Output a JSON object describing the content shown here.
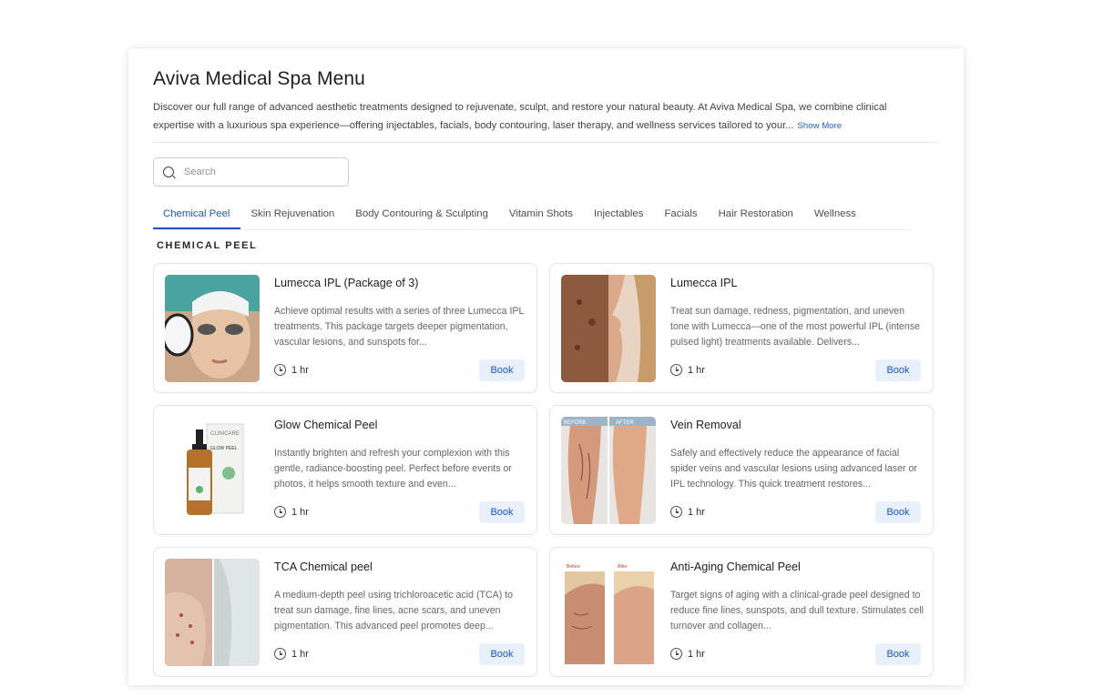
{
  "menu": {
    "title": "Aviva Medical Spa Menu",
    "description": "Discover our full range of advanced aesthetic treatments designed to rejuvenate, sculpt, and restore your natural beauty. At Aviva Medical Spa, we combine clinical expertise with a luxurious spa experience—offering injectables, facials, body contouring, laser therapy, and wellness services tailored to your...",
    "show_more_label": "Show More"
  },
  "search": {
    "placeholder": "Search",
    "value": ""
  },
  "tabs": [
    {
      "label": "Chemical Peel",
      "active": true
    },
    {
      "label": "Skin Rejuvenation",
      "active": false
    },
    {
      "label": "Body Contouring & Sculpting",
      "active": false
    },
    {
      "label": "Vitamin Shots",
      "active": false
    },
    {
      "label": "Injectables",
      "active": false
    },
    {
      "label": "Facials",
      "active": false
    },
    {
      "label": "Hair Restoration",
      "active": false
    },
    {
      "label": "Wellness",
      "active": false
    }
  ],
  "section": {
    "title": "CHEMICAL PEEL"
  },
  "services": [
    {
      "name": "Lumecca IPL (Package of 3)",
      "description": "Achieve optimal results with a series of three Lumecca IPL treatments. This package targets deeper pigmentation, vascular lesions, and sunspots for...",
      "duration": "1 hr",
      "book_label": "Book"
    },
    {
      "name": "Lumecca IPL",
      "description": "Treat sun damage, redness, pigmentation, and uneven tone with Lumecca—one of the most powerful IPL (intense pulsed light) treatments available. Delivers...",
      "duration": "1 hr",
      "book_label": "Book"
    },
    {
      "name": "Glow Chemical Peel",
      "description": "Instantly brighten and refresh your complexion with this gentle, radiance-boosting peel. Perfect before events or photos, it helps smooth texture and even...",
      "duration": "1 hr",
      "book_label": "Book",
      "image_text": {
        "brand": "CLINICARE",
        "product": "GLOW PEEL"
      }
    },
    {
      "name": "Vein Removal",
      "description": "Safely and effectively reduce the appearance of facial spider veins and vascular lesions using advanced laser or IPL technology. This quick treatment restores...",
      "duration": "1 hr",
      "book_label": "Book",
      "image_text": {
        "before": "BEFORE",
        "after": "AFTER"
      }
    },
    {
      "name": "TCA Chemical peel",
      "description": "A medium-depth peel using trichloroacetic acid (TCA) to treat sun damage, fine lines, acne scars, and uneven pigmentation. This advanced peel promotes deep...",
      "duration": "1 hr",
      "book_label": "Book"
    },
    {
      "name": "Anti-Aging Chemical Peel",
      "description": "Target signs of aging with a clinical-grade peel designed to reduce fine lines, sunspots, and dull texture. Stimulates cell turnover and collagen...",
      "duration": "1 hr",
      "book_label": "Book",
      "image_text": {
        "before": "Before",
        "after": "After"
      }
    }
  ],
  "colors": {
    "accent": "#1a56c4",
    "book_button_bg": "#e8f0fc",
    "text_primary": "#1d1f22",
    "text_secondary": "#62666c"
  },
  "icons": {
    "search": "search-icon",
    "duration": "clock-icon"
  }
}
